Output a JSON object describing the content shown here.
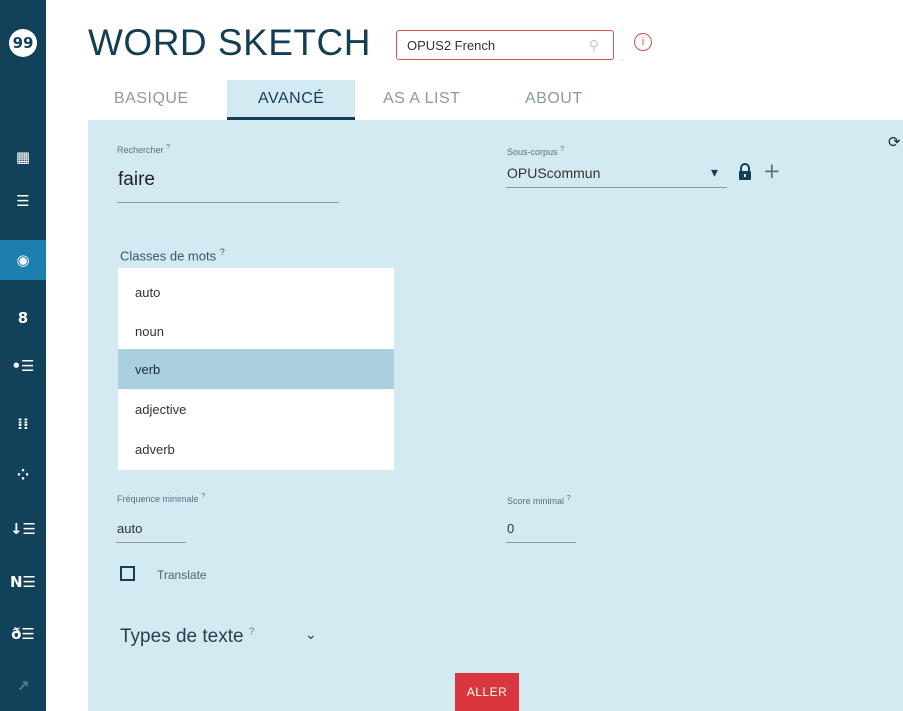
{
  "app": {
    "title": "WORD SKETCH",
    "logo": "99"
  },
  "corpus": {
    "value": "OPUS2 French",
    "icon": "search-icon"
  },
  "info": {
    "glyph": "i",
    "icon": "info-icon"
  },
  "tabs": [
    {
      "label": "BASIQUE",
      "active": false
    },
    {
      "label": "AVANCÉ",
      "active": true
    },
    {
      "label": "AS A LIST",
      "active": false
    },
    {
      "label": "ABOUT",
      "active": false
    }
  ],
  "sidebar": {
    "items": [
      {
        "icon": "dashboard-icon",
        "glyph": "▦"
      },
      {
        "icon": "list-icon",
        "glyph": "☰"
      },
      {
        "icon": "word-sketch-icon",
        "glyph": "◉",
        "active": true
      },
      {
        "icon": "sketch-diff-icon",
        "glyph": "8"
      },
      {
        "icon": "bullet-list-icon",
        "glyph": "•☰"
      },
      {
        "icon": "concordance-icon",
        "glyph": "⁞⁞"
      },
      {
        "icon": "grid-icon",
        "glyph": "⁘"
      },
      {
        "icon": "sort-list-icon",
        "glyph": "↓☰"
      },
      {
        "icon": "ngram-icon",
        "glyph": "N☰"
      },
      {
        "icon": "keywords-icon",
        "glyph": "ð☰"
      },
      {
        "icon": "trends-icon",
        "glyph": "↗"
      }
    ]
  },
  "form": {
    "search": {
      "label": "Rechercher",
      "help": "?",
      "value": "faire"
    },
    "subcorpus": {
      "label": "Sous-corpus",
      "help": "?",
      "value": "OPUScommun",
      "dropdown": "▾",
      "lock_icon": "lock-icon",
      "add": "+"
    },
    "word_classes": {
      "label": "Classes de mots",
      "help": "?",
      "options": [
        "auto",
        "noun",
        "verb",
        "adjective",
        "adverb"
      ],
      "selected": "verb"
    },
    "min_freq": {
      "label": "Fréquence minimale",
      "help": "?",
      "value": "auto"
    },
    "min_score": {
      "label": "Score minimal",
      "help": "?",
      "value": "0"
    },
    "translate": {
      "label": "Translate",
      "checked": false
    },
    "text_types": {
      "label": "Types de texte",
      "help": "?",
      "chevron": "⌄"
    },
    "submit": {
      "label": "ALLER"
    }
  },
  "colors": {
    "sidebar": "#12415a",
    "sidebar_active": "#1d7fb0",
    "panel": "#d3eaf3",
    "accent": "#d9363e",
    "selected_option": "#a9cfe0"
  }
}
